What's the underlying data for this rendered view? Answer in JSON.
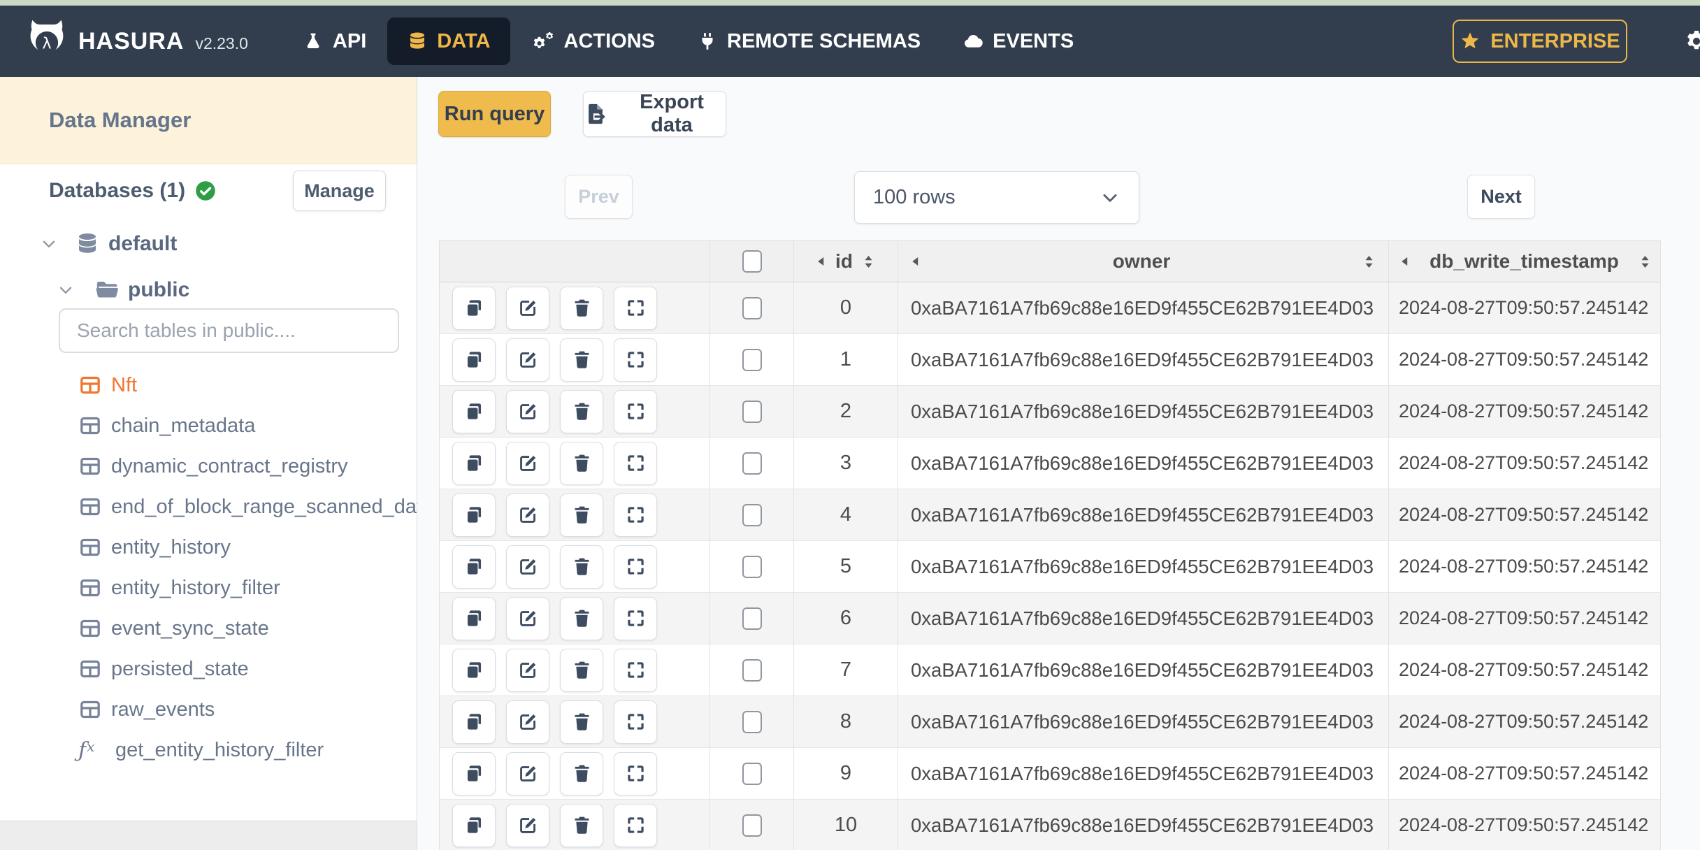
{
  "topnav": {
    "brand": "HASURA",
    "version": "v2.23.0",
    "tabs": [
      {
        "label": "API"
      },
      {
        "label": "DATA"
      },
      {
        "label": "ACTIONS"
      },
      {
        "label": "REMOTE SCHEMAS"
      },
      {
        "label": "EVENTS"
      }
    ],
    "enterprise_label": "ENTERPRISE"
  },
  "sidebar": {
    "title": "Data Manager",
    "databases_label": "Databases (1)",
    "manage_label": "Manage",
    "tree": {
      "database": "default",
      "schema": "public"
    },
    "search_placeholder": "Search tables in public....",
    "tables": [
      {
        "label": "Nft",
        "type": "table",
        "active": true
      },
      {
        "label": "chain_metadata",
        "type": "table"
      },
      {
        "label": "dynamic_contract_registry",
        "type": "table"
      },
      {
        "label": "end_of_block_range_scanned_data",
        "type": "table"
      },
      {
        "label": "entity_history",
        "type": "table"
      },
      {
        "label": "entity_history_filter",
        "type": "table"
      },
      {
        "label": "event_sync_state",
        "type": "table"
      },
      {
        "label": "persisted_state",
        "type": "table"
      },
      {
        "label": "raw_events",
        "type": "table"
      },
      {
        "label": "get_entity_history_filter",
        "type": "function"
      }
    ]
  },
  "toolbar": {
    "run_query_label": "Run query",
    "export_data_label": "Export data"
  },
  "pagination": {
    "prev_label": "Prev",
    "rows_value": "100 rows",
    "next_label": "Next"
  },
  "table": {
    "columns": [
      "id",
      "owner",
      "db_write_timestamp"
    ],
    "rows": [
      {
        "id": "0",
        "owner": "0xaBA7161A7fb69c88e16ED9f455CE62B791EE4D03",
        "ts": "2024-08-27T09:50:57.245142"
      },
      {
        "id": "1",
        "owner": "0xaBA7161A7fb69c88e16ED9f455CE62B791EE4D03",
        "ts": "2024-08-27T09:50:57.245142"
      },
      {
        "id": "2",
        "owner": "0xaBA7161A7fb69c88e16ED9f455CE62B791EE4D03",
        "ts": "2024-08-27T09:50:57.245142"
      },
      {
        "id": "3",
        "owner": "0xaBA7161A7fb69c88e16ED9f455CE62B791EE4D03",
        "ts": "2024-08-27T09:50:57.245142"
      },
      {
        "id": "4",
        "owner": "0xaBA7161A7fb69c88e16ED9f455CE62B791EE4D03",
        "ts": "2024-08-27T09:50:57.245142"
      },
      {
        "id": "5",
        "owner": "0xaBA7161A7fb69c88e16ED9f455CE62B791EE4D03",
        "ts": "2024-08-27T09:50:57.245142"
      },
      {
        "id": "6",
        "owner": "0xaBA7161A7fb69c88e16ED9f455CE62B791EE4D03",
        "ts": "2024-08-27T09:50:57.245142"
      },
      {
        "id": "7",
        "owner": "0xaBA7161A7fb69c88e16ED9f455CE62B791EE4D03",
        "ts": "2024-08-27T09:50:57.245142"
      },
      {
        "id": "8",
        "owner": "0xaBA7161A7fb69c88e16ED9f455CE62B791EE4D03",
        "ts": "2024-08-27T09:50:57.245142"
      },
      {
        "id": "9",
        "owner": "0xaBA7161A7fb69c88e16ED9f455CE62B791EE4D03",
        "ts": "2024-08-27T09:50:57.245142"
      },
      {
        "id": "10",
        "owner": "0xaBA7161A7fb69c88e16ED9f455CE62B791EE4D03",
        "ts": "2024-08-27T09:50:57.245142"
      }
    ]
  },
  "colors": {
    "navbar_bg": "#323e4d",
    "accent_yellow": "#eeb748",
    "run_query_yellow": "#f0bb4d",
    "nft_orange": "#f0772e",
    "success_green": "#2e9e44",
    "sidebar_header_cream": "#fcf3da",
    "top_strip_green": "#ccd9c3"
  }
}
